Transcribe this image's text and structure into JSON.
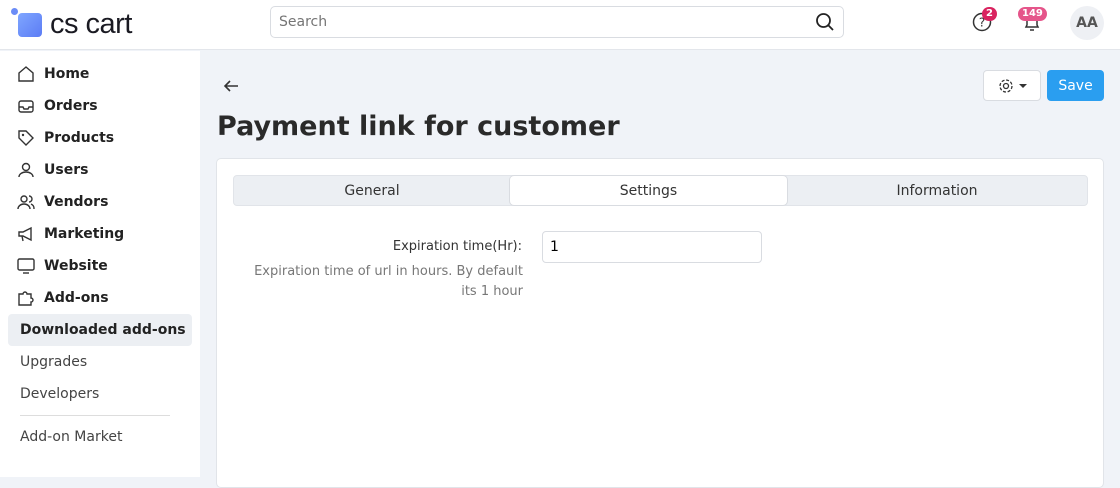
{
  "header": {
    "logo": "cs cart",
    "search_placeholder": "Search",
    "help_badge": "2",
    "notifications_badge": "149",
    "avatar": "AA"
  },
  "sidebar": {
    "items": [
      {
        "label": "Home"
      },
      {
        "label": "Orders"
      },
      {
        "label": "Products"
      },
      {
        "label": "Users"
      },
      {
        "label": "Vendors"
      },
      {
        "label": "Marketing"
      },
      {
        "label": "Website"
      },
      {
        "label": "Add-ons"
      }
    ],
    "sub": [
      {
        "label": "Downloaded add-ons"
      },
      {
        "label": "Upgrades"
      },
      {
        "label": "Developers"
      }
    ],
    "market": "Add-on Market"
  },
  "page": {
    "title": "Payment link for customer",
    "save": "Save",
    "tabs": [
      {
        "label": "General"
      },
      {
        "label": "Settings"
      },
      {
        "label": "Information"
      }
    ],
    "field": {
      "label": "Expiration time(Hr):",
      "value": "1",
      "help": "Expiration time of url in hours. By default its 1 hour"
    }
  }
}
